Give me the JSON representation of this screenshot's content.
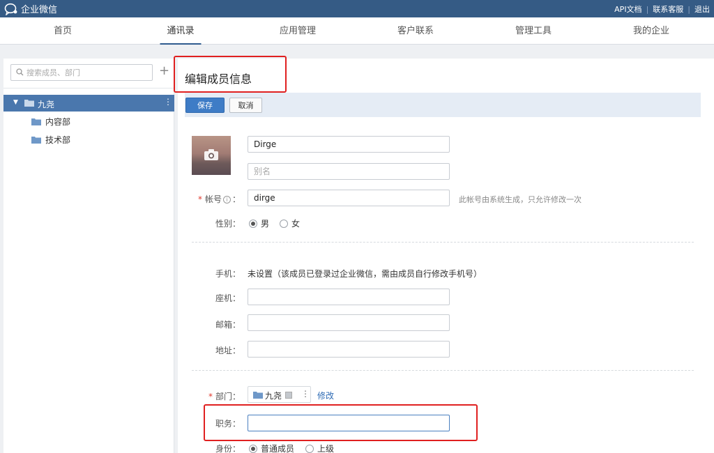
{
  "app": {
    "name": "企业微信"
  },
  "top_links": [
    "API文档",
    "联系客服",
    "退出"
  ],
  "nav": {
    "tabs": [
      {
        "label": "首页",
        "active": false
      },
      {
        "label": "通讯录",
        "active": true
      },
      {
        "label": "应用管理",
        "active": false
      },
      {
        "label": "客户联系",
        "active": false
      },
      {
        "label": "管理工具",
        "active": false
      },
      {
        "label": "我的企业",
        "active": false
      }
    ]
  },
  "sidebar": {
    "search_placeholder": "搜索成员、部门",
    "add_label": "+",
    "root": {
      "label": "九尧",
      "expanded": true
    },
    "children": [
      "内容部",
      "技术部"
    ]
  },
  "main": {
    "title": "编辑成员信息",
    "save_label": "保存",
    "cancel_label": "取消",
    "name_value": "Dirge",
    "alias_placeholder": "别名",
    "account_label": "帐号",
    "account_value": "dirge",
    "account_hint": "此帐号由系统生成，只允许修改一次",
    "gender_label": "性别",
    "gender_male": "男",
    "gender_female": "女",
    "gender_selected": "男",
    "phone_label": "手机",
    "phone_note": "未设置（该成员已登录过企业微信，需由成员自行修改手机号）",
    "landline_label": "座机",
    "email_label": "邮箱",
    "address_label": "地址",
    "dept_label": "部门",
    "dept_value": "九尧",
    "dept_modify": "修改",
    "job_label": "职务",
    "identity_label": "身份",
    "identity_normal": "普通成员",
    "identity_superior": "上级",
    "identity_selected": "普通成员"
  },
  "colors": {
    "topbar": "#355b85",
    "accent": "#3e7cc6",
    "highlight": "#e02020",
    "tree_selected": "#4a77ad"
  }
}
